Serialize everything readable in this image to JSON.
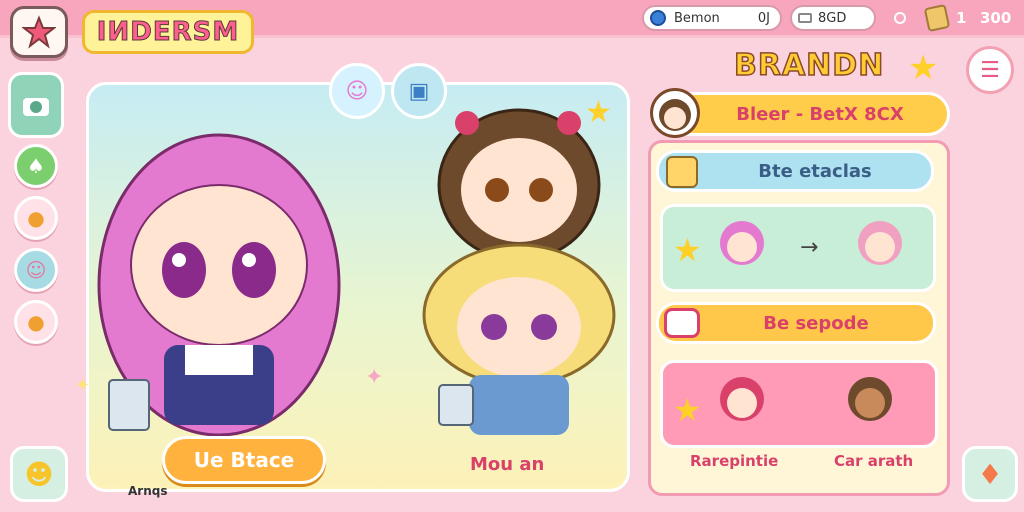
{
  "header": {
    "logo_text": "IИDERSM",
    "player_name": "Bemon",
    "player_level": "0J",
    "code_text": "8GD",
    "stat_primary": "1",
    "stat_secondary": "300"
  },
  "stage": {
    "action_button_label": "Ue Btace",
    "character_caption": "Mou an",
    "corner_caption": "Arnqs"
  },
  "panel": {
    "title": "BRANDN",
    "header_banner": "Bleer - BetX 8CX",
    "section_a_label": "Bte etaclas",
    "section_b_label": "Be sepode",
    "card_label_left": "Rarepintie",
    "card_label_right": "Car arath"
  },
  "colors": {
    "background": "#fbd3df",
    "topbar": "#f8a6bd",
    "accent_pink": "#d9416a",
    "accent_yellow": "#ffcd4a",
    "accent_teal": "#8fd4b9"
  },
  "icons": {
    "home": "home-star-icon",
    "menu": "menu-icon",
    "coin": "coin-icon",
    "gem": "gem-icon",
    "rail": [
      "camera-icon",
      "leaf-icon",
      "cat-icon",
      "face-icon",
      "bread-icon"
    ],
    "bottom_left": "sun-face-icon",
    "bottom_right": "bell-icon"
  }
}
